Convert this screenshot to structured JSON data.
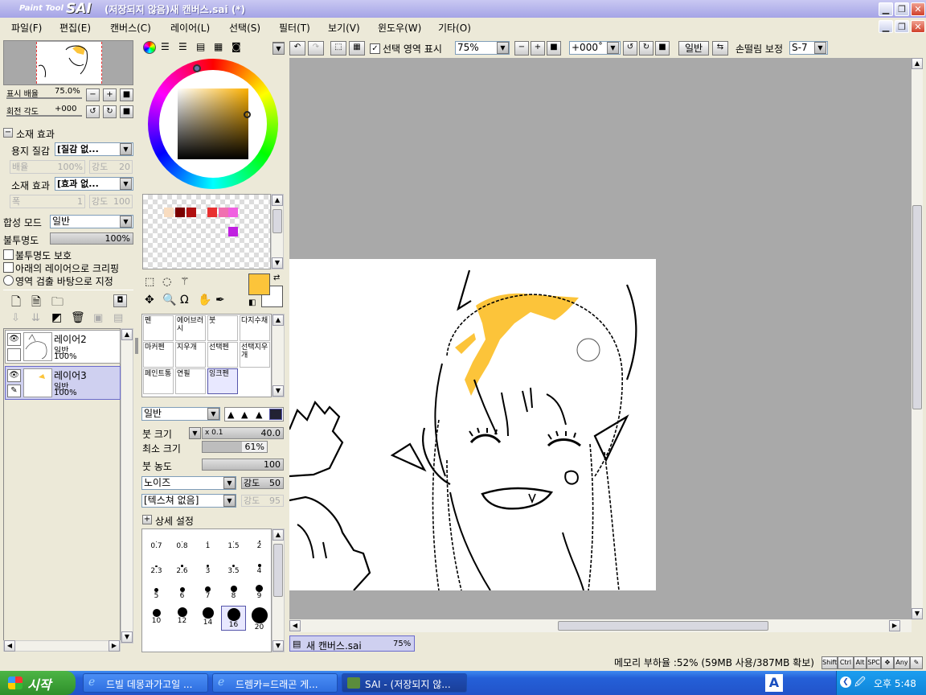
{
  "window": {
    "logo_small": "Paint Tool",
    "logo_big": "SAI",
    "title": "(저장되지 않음)새 캔버스.sai (*)",
    "minimize": "▁",
    "maximize": "❐",
    "close": "✕"
  },
  "menu": [
    "파일(F)",
    "편집(E)",
    "캔버스(C)",
    "레이어(L)",
    "선택(S)",
    "필터(T)",
    "보기(V)",
    "윈도우(W)",
    "기타(O)"
  ],
  "navigator": {
    "zoom_label": "표시 배율",
    "zoom_value": "75.0%",
    "rotate_label": "회전 각도",
    "rotate_value": "+000"
  },
  "material": {
    "header": "소재 효과",
    "paper_label": "용지 질감",
    "paper_value": "[질감 없...",
    "scale_label": "배율",
    "scale_value": "100%",
    "strength_label": "강도",
    "strength_value": "20",
    "effect_label": "소재 효과",
    "effect_value": "[효과 없...",
    "width_label": "폭",
    "width_value": "1",
    "strength2_label": "강도",
    "strength2_value": "100"
  },
  "layer_props": {
    "blend_label": "합성 모드",
    "blend_value": "일반",
    "opacity_label": "불투명도",
    "opacity_value": "100%",
    "protect_opacity": "불투명도 보호",
    "clip_below": "아래의 레이어으로 크리핑",
    "selection_source": "영역 검출 바탕으로 지정"
  },
  "layers": [
    {
      "name": "레이어2",
      "mode": "일반",
      "opacity": "100%"
    },
    {
      "name": "레이어3",
      "mode": "일반",
      "opacity": "100%"
    }
  ],
  "swatches": [
    "#f8dcc0",
    "#7a0000",
    "#b01010",
    "#e83030",
    "#f070b0",
    "#f060e0",
    "#c020e0"
  ],
  "current_color": "#fcc43a",
  "tools": [
    [
      "펜",
      "에어브러시",
      "붓",
      "다지수채"
    ],
    [
      "마커펜",
      "지우개",
      "선택펜",
      "선택지우개"
    ],
    [
      "페인트통",
      "연필",
      "잉크펜",
      ""
    ]
  ],
  "brush": {
    "mode": "일반",
    "size_label": "붓 크기",
    "size_mult": "x 0.1",
    "size_value": "40.0",
    "min_label": "최소 크기",
    "min_value": "61%",
    "density_label": "붓 농도",
    "density_value": "100",
    "noise_value": "노이즈",
    "noise_strength_label": "강도",
    "noise_strength_value": "50",
    "texture_value": "[텍스쳐 없음]",
    "texture_strength_label": "강도",
    "texture_strength_value": "95",
    "detail_label": "상세 설정",
    "sizes": [
      "0.7",
      "0.8",
      "1",
      "1.5",
      "2",
      "2.3",
      "2.6",
      "3",
      "3.5",
      "4",
      "5",
      "6",
      "7",
      "8",
      "9",
      "10",
      "12",
      "14",
      "16",
      "20"
    ]
  },
  "toolbar": {
    "show_selection": "선택 영역 표시",
    "zoom": "75%",
    "rotation": "+000˚",
    "mode": "일반",
    "stabilizer_label": "손떨림 보정",
    "stabilizer_value": "S-7"
  },
  "doc_tab": {
    "name": "새 캔버스.sai",
    "zoom": "75%"
  },
  "status": {
    "memory": "메모리 부하율 :52% (59MB 사용/387MB 확보)",
    "keys": [
      "Shift",
      "Ctrl",
      "Alt",
      "SPC",
      "✥",
      "Any",
      "✎"
    ]
  },
  "taskbar": {
    "start": "시작",
    "items": [
      "드빌 데몽과가고일 ...",
      "드렘카=드래곤 게...",
      "SAI - (저장되지 않..."
    ],
    "ime": "A",
    "clock": "오후 5:48"
  }
}
